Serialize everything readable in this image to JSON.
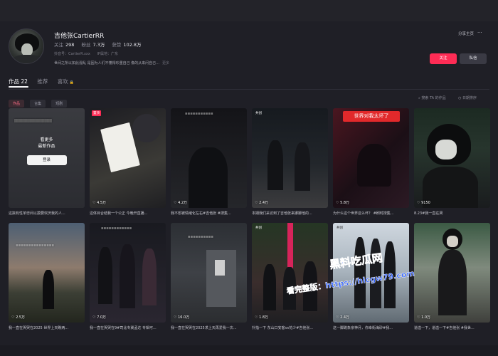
{
  "profile": {
    "name": "吉他张CartierRR",
    "follow_label": "关注",
    "follow_count": "298",
    "fans_label": "粉丝",
    "fans_count": "7.3万",
    "likes_label": "获赞",
    "likes_count": "102.8万",
    "douyin_id": "抖音号：CartierR.xxx",
    "ip_location": "IP属地：广东",
    "bio": "世间之所以如此混乱 是因为人们不懂得珍重自己 像的从来问自己...",
    "bio_more": "更多"
  },
  "actions": {
    "share": "分享主页",
    "more": "···",
    "follow_button": "关注",
    "message_button": "私信"
  },
  "tabs": [
    {
      "label": "作品 22"
    },
    {
      "label": "推荐"
    },
    {
      "label": "喜欢"
    }
  ],
  "chips": [
    "作品",
    "合集",
    "短剧"
  ],
  "search_works": "搜索 TA 的作品",
  "sort": "日期排序",
  "cards": [
    {
      "likes": "",
      "caption": "这挨有性单忠间以摸要欢厌我的人...",
      "login_title_1": "看更多",
      "login_title_2": "最新作品",
      "login_button": "登录"
    },
    {
      "likes": "4.5万",
      "caption": "这体目合结我一个公正 今晚开直播...",
      "badge": "置顶"
    },
    {
      "likes": "4.2万",
      "caption": "我不想被情绪化左右#吉他张 #搜集..."
    },
    {
      "likes": "2.4万",
      "caption": "本期我们采访到了吉他张来娜娜他的...",
      "badge": "共创"
    },
    {
      "likes": "5.8万",
      "caption": "为什么这个世界这么坏？ #刷时搜集...",
      "banner": "世界对我太坏了"
    },
    {
      "likes": "9150",
      "caption": "8.23#我一直在哭"
    },
    {
      "likes": "2.5万",
      "caption": "我一直在哭哭在2025 世界上天瞧两..."
    },
    {
      "likes": "7.0万",
      "caption": "我一直在哭哭在9#司比专冀孟达 专辑可..."
    },
    {
      "likes": "16.0万",
      "caption": "我一直在哭哭在2025求上天再爱我一次..."
    },
    {
      "likes": "1.8万",
      "caption": "扑指一下 东山口安客vs花少#吉他张...",
      "badge": "共创"
    },
    {
      "likes": "2.4万",
      "caption": "这一脚跳象亲神月，你幸街海砂#我...",
      "badge": "共创"
    },
    {
      "likes": "1.0万",
      "caption": "道溢一下，道溢一下#吉他张 #我世..."
    }
  ],
  "watermark": {
    "big": "黑料吃瓜网",
    "url": "看完整版：https://hlcgw79.com"
  }
}
